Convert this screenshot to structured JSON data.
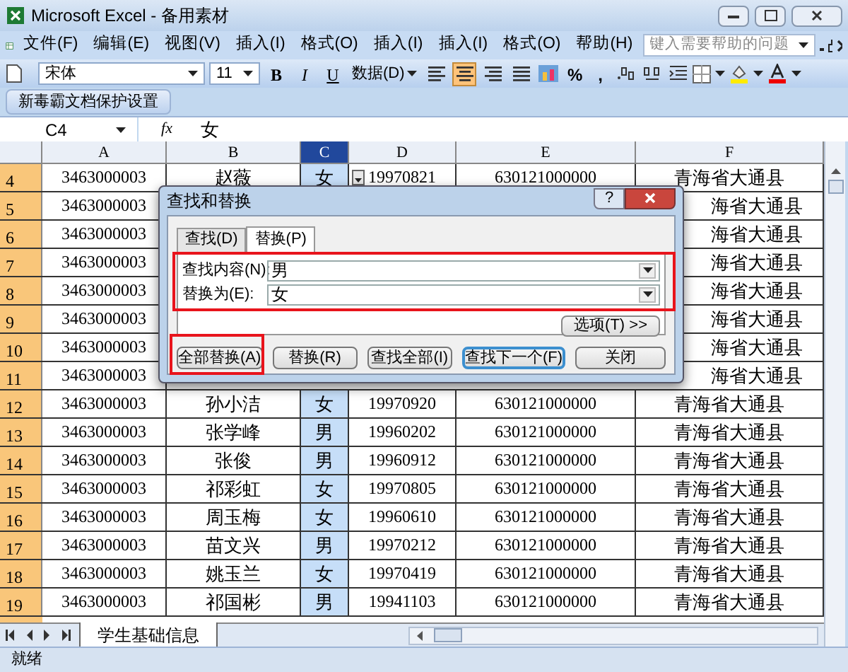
{
  "window": {
    "title": "Microsoft Excel - 备用素材"
  },
  "menu": {
    "items": [
      "文件(F)",
      "编辑(E)",
      "视图(V)",
      "插入(I)",
      "格式(O)",
      "插入(I)",
      "插入(I)",
      "格式(O)",
      "帮助(H)"
    ],
    "help_box": {
      "placeholder": "键入需要帮助的问题"
    }
  },
  "toolbar": {
    "font": "宋体",
    "size": "11",
    "style_buttons": [
      {
        "label": "B",
        "kind": "bold"
      },
      {
        "label": "I",
        "kind": "italic"
      },
      {
        "label": "U",
        "kind": "underline"
      }
    ],
    "data_menu": "数据(D)",
    "align_buttons": [
      {
        "kind": "left",
        "selected": false
      },
      {
        "kind": "center",
        "selected": true
      },
      {
        "kind": "right",
        "selected": false
      },
      {
        "kind": "merge",
        "selected": false
      }
    ],
    "symbol_buttons": [
      "%",
      ","
    ]
  },
  "toolbar2": {
    "button": "新毒霸文档保护设置"
  },
  "formula_bar": {
    "name_box": "C4",
    "fx": "fx",
    "value": "女"
  },
  "columns": [
    {
      "label": "A",
      "selected": false
    },
    {
      "label": "B",
      "selected": false
    },
    {
      "label": "C",
      "selected": true
    },
    {
      "label": "D",
      "selected": false
    },
    {
      "label": "E",
      "selected": false
    },
    {
      "label": "F",
      "selected": false
    }
  ],
  "rows": [
    {
      "header": "4",
      "covered": false,
      "cells": [
        "3463000003",
        "赵薇",
        "女",
        "19970821",
        "630121000000",
        "青海省大通县"
      ]
    },
    {
      "header": "5",
      "covered": true,
      "cells": [
        "3463000003",
        "海省大通县"
      ]
    },
    {
      "header": "6",
      "covered": true,
      "cells": [
        "3463000003",
        "海省大通县"
      ]
    },
    {
      "header": "7",
      "covered": true,
      "cells": [
        "3463000003",
        "海省大通县"
      ]
    },
    {
      "header": "8",
      "covered": true,
      "cells": [
        "3463000003",
        "海省大通县"
      ]
    },
    {
      "header": "9",
      "covered": true,
      "cells": [
        "3463000003",
        "海省大通县"
      ]
    },
    {
      "header": "10",
      "covered": true,
      "cells": [
        "3463000003",
        "海省大通县"
      ]
    },
    {
      "header": "11",
      "covered": true,
      "cells": [
        "3463000003",
        "海省大通县"
      ]
    },
    {
      "header": "12",
      "covered": false,
      "cells": [
        "3463000003",
        "孙小洁",
        "女",
        "19970920",
        "630121000000",
        "青海省大通县"
      ]
    },
    {
      "header": "13",
      "covered": false,
      "cells": [
        "3463000003",
        "张学峰",
        "男",
        "19960202",
        "630121000000",
        "青海省大通县"
      ]
    },
    {
      "header": "14",
      "covered": false,
      "cells": [
        "3463000003",
        "张俊",
        "男",
        "19960912",
        "630121000000",
        "青海省大通县"
      ]
    },
    {
      "header": "15",
      "covered": false,
      "cells": [
        "3463000003",
        "祁彩虹",
        "女",
        "19970805",
        "630121000000",
        "青海省大通县"
      ]
    },
    {
      "header": "16",
      "covered": false,
      "cells": [
        "3463000003",
        "周玉梅",
        "女",
        "19960610",
        "630121000000",
        "青海省大通县"
      ]
    },
    {
      "header": "17",
      "covered": false,
      "cells": [
        "3463000003",
        "苗文兴",
        "男",
        "19970212",
        "630121000000",
        "青海省大通县"
      ]
    },
    {
      "header": "18",
      "covered": false,
      "cells": [
        "3463000003",
        "姚玉兰",
        "女",
        "19970419",
        "630121000000",
        "青海省大通县"
      ]
    },
    {
      "header": "19",
      "covered": false,
      "cells": [
        "3463000003",
        "祁国彬",
        "男",
        "19941103",
        "630121000000",
        "青海省大通县"
      ]
    }
  ],
  "dialog": {
    "title": "查找和替换",
    "help": "?",
    "tabs": [
      {
        "label": "查找(D)",
        "selected": false
      },
      {
        "label": "替换(P)",
        "selected": true
      }
    ],
    "fields": [
      {
        "label": "查找内容(N):",
        "value": "男"
      },
      {
        "label": "替换为(E):",
        "value": "女"
      }
    ],
    "options_button": "选项(T) >>",
    "buttons": [
      {
        "label": "全部替换(A)",
        "default": false
      },
      {
        "label": "替换(R)",
        "default": false
      },
      {
        "label": "查找全部(I)",
        "default": false
      },
      {
        "label": "查找下一个(F)",
        "default": true
      },
      {
        "label": "关闭",
        "default": false
      }
    ]
  },
  "sheet_tabs": [
    {
      "label": "学生基础信息",
      "selected": true
    }
  ],
  "status_bar": {
    "text": "就绪"
  }
}
